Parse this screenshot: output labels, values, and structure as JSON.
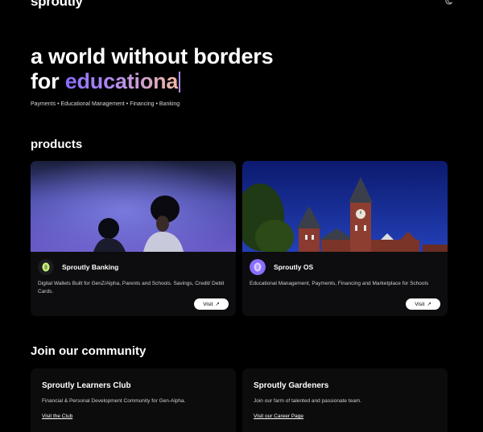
{
  "header": {
    "logo": "sproutly",
    "theme_icon": "moon-icon"
  },
  "hero": {
    "line1": "a world without borders",
    "line2_prefix": "for ",
    "line2_highlight": "educationa",
    "tagline": "Payments • Educational Management • Financing • Banking",
    "gradient": [
      "#8a6cff",
      "#b48ef0",
      "#f0b8a0"
    ]
  },
  "products": {
    "title": "products",
    "cards": [
      {
        "name": "Sproutly Banking",
        "description": "Digital Wallets Built for GenZ/Alpha, Parents and Schools. Savings, Credit/ Debit Cards.",
        "button": "Visit",
        "button_icon": "↗",
        "icon": "coin-icon",
        "icon_color": "#c8f57a"
      },
      {
        "name": "Sproutly OS",
        "description": "Educational Management, Payments, Financing and Marketplace for Schools",
        "button": "Visit",
        "button_icon": "↗",
        "icon": "coin-icon",
        "icon_color": "#8a6cff"
      }
    ]
  },
  "community": {
    "title": "Join our community",
    "cards": [
      {
        "name": "Sproutly Learners Club",
        "description": "Financial & Personal Development Community for Gen-Alpha.",
        "link": "Visit the Club"
      },
      {
        "name": "Sproutly Gardeners",
        "description": "Join our farm of talented and passionate team.",
        "link": "Visit our Career Page"
      }
    ]
  }
}
